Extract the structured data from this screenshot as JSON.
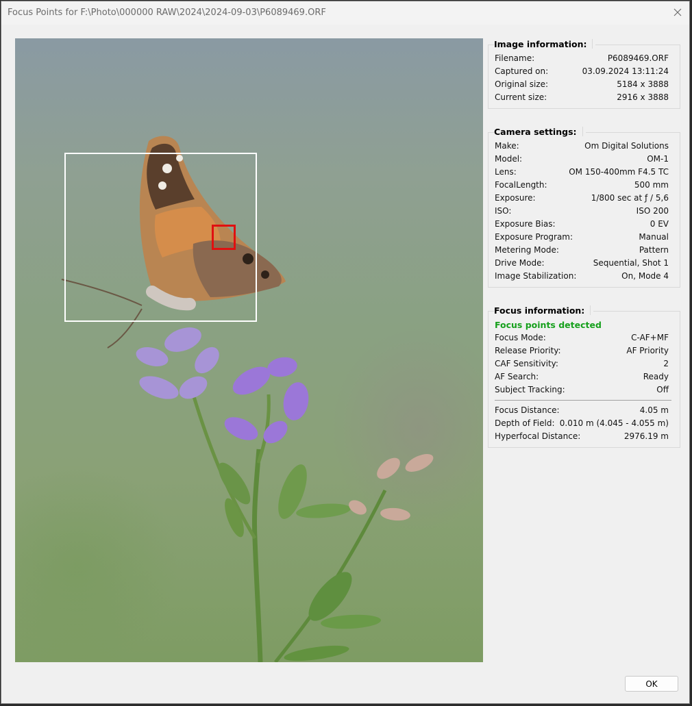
{
  "window": {
    "title": "Focus Points for F:\\Photo\\000000 RAW\\2024\\2024-09-03\\P6089469.ORF",
    "close_icon": "close-icon"
  },
  "image_info": {
    "title": "Image information:",
    "rows": [
      {
        "label": "Filename:",
        "value": "P6089469.ORF"
      },
      {
        "label": "Captured on:",
        "value": "03.09.2024 13:11:24"
      },
      {
        "label": "Original size:",
        "value": "5184 x 3888"
      },
      {
        "label": "Current size:",
        "value": "2916 x 3888"
      }
    ]
  },
  "camera_settings": {
    "title": "Camera settings:",
    "rows": [
      {
        "label": "Make:",
        "value": "Om Digital Solutions"
      },
      {
        "label": "Model:",
        "value": "OM-1"
      },
      {
        "label": "Lens:",
        "value": "OM 150-400mm F4.5 TC"
      },
      {
        "label": "FocalLength:",
        "value": "500 mm"
      },
      {
        "label": "Exposure:",
        "value": "1/800 sec at ƒ / 5,6"
      },
      {
        "label": "ISO:",
        "value": "ISO 200"
      },
      {
        "label": "Exposure Bias:",
        "value": "0 EV"
      },
      {
        "label": "Exposure Program:",
        "value": "Manual"
      },
      {
        "label": "Metering Mode:",
        "value": "Pattern"
      },
      {
        "label": "Drive Mode:",
        "value": "Sequential, Shot 1"
      },
      {
        "label": "Image Stabilization:",
        "value": "On, Mode 4"
      }
    ]
  },
  "focus_info": {
    "title": "Focus information:",
    "status": "Focus points detected",
    "status_color": "#16a01c",
    "rows": [
      {
        "label": "Focus Mode:",
        "value": "C-AF+MF"
      },
      {
        "label": "Release Priority:",
        "value": "AF Priority"
      },
      {
        "label": "CAF Sensitivity:",
        "value": "2"
      },
      {
        "label": "AF Search:",
        "value": "Ready"
      },
      {
        "label": "Subject Tracking:",
        "value": "Off"
      }
    ],
    "rows_after_separator": [
      {
        "label": "Focus Distance:",
        "value": "4.05 m"
      },
      {
        "label": "Depth of Field:",
        "value": "0.010 m (4.045 - 4.055 m)"
      },
      {
        "label": "Hyperfocal Distance:",
        "value": "2976.19 m"
      }
    ]
  },
  "photo": {
    "subject": "butterfly-on-flower-photo",
    "af_frame_color": "#ffffff",
    "af_point_color": "#e01010"
  },
  "buttons": {
    "ok_label": "OK"
  }
}
